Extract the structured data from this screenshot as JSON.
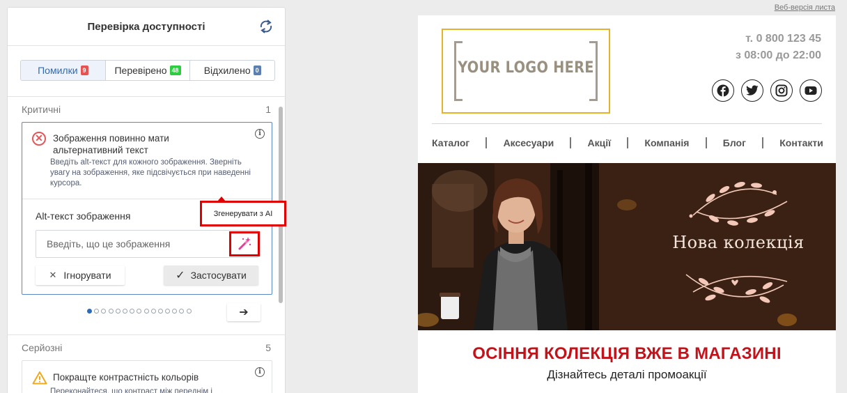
{
  "panel": {
    "title": "Перевірка доступності",
    "tabs": [
      {
        "label": "Помилки",
        "count": "9",
        "color": "#e55353"
      },
      {
        "label": "Перевірено",
        "count": "48",
        "color": "#2ecc40"
      },
      {
        "label": "Відхилено",
        "count": "0",
        "color": "#5a7fb0"
      }
    ],
    "critical": {
      "label": "Критичні",
      "count": "1"
    },
    "issue": {
      "title": "Зображення повинно мати альтернативний текст",
      "description": "Введіть alt-текст для кожного зображення. Зверніть увагу на зображення, яке підсвічується при наведенні курсора.",
      "alt_label": "Alt-текст зображення",
      "alt_placeholder": "Введіть, що це зображення",
      "tooltip": "Згенерувати з AI",
      "ignore_label": "Ігнорувати",
      "apply_label": "Застосувати"
    },
    "pagination": {
      "total": 15,
      "active": 1
    },
    "serious": {
      "label": "Серйозні",
      "count": "5"
    },
    "warning": {
      "title": "Покращте контрастність кольорів",
      "description": "Переконайтеся, що контраст між переднім і"
    }
  },
  "email": {
    "web_version": "Веб-версія листа",
    "logo": "YOUR LOGO HERE",
    "phone": "т. 0 800 123 45",
    "hours": "з 08:00 до 22:00",
    "socials": [
      "facebook-icon",
      "twitter-icon",
      "instagram-icon",
      "youtube-icon"
    ],
    "menu": [
      "Каталог",
      "Аксесуари",
      "Акції",
      "Компанія",
      "Блог",
      "Контакти"
    ],
    "banner_text": "Нова колекція",
    "headline": "ОСІННЯ КОЛЕКЦІЯ ВЖЕ В МАГАЗИНІ",
    "subline": "Дізнайтесь деталі промоакції"
  }
}
